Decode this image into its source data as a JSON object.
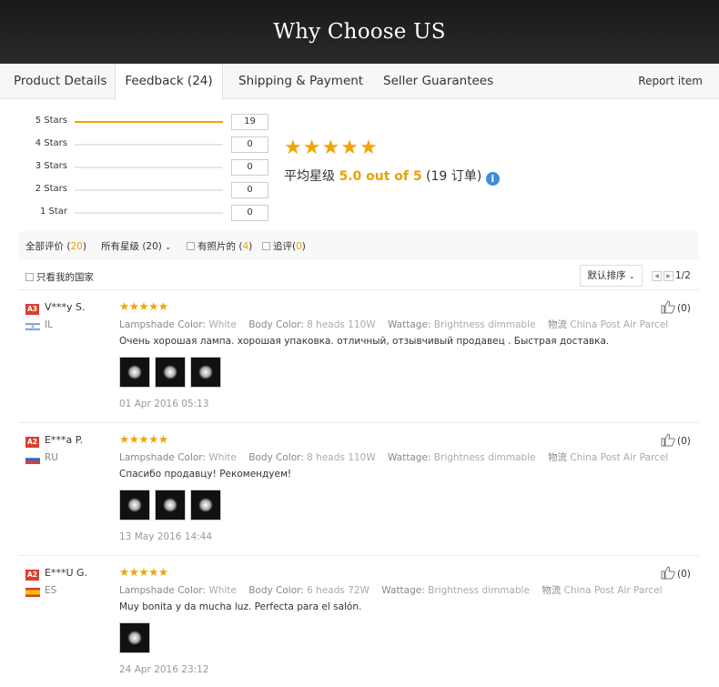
{
  "banner": {
    "title": "Why Choose US"
  },
  "tabs": [
    {
      "label": "Product Details"
    },
    {
      "label": "Feedback (24)"
    },
    {
      "label": "Shipping & Payment"
    },
    {
      "label": "Seller Guarantees"
    }
  ],
  "report_label": "Report item",
  "rating_breakdown": [
    {
      "label": "5 Stars",
      "count": "19",
      "fraction": 1.0
    },
    {
      "label": "4 Stars",
      "count": "0",
      "fraction": 0
    },
    {
      "label": "3 Stars",
      "count": "0",
      "fraction": 0
    },
    {
      "label": "2 Stars",
      "count": "0",
      "fraction": 0
    },
    {
      "label": "1 Star",
      "count": "0",
      "fraction": 0
    }
  ],
  "summary": {
    "stars": 5,
    "prefix": "平均星级 ",
    "score": "5.0 out of 5",
    "orders": " (19 订单)",
    "info_icon": "info-icon"
  },
  "filters": {
    "all_label": "全部评价 (",
    "all_count": "20",
    "all_close": ")",
    "star_filter": "所有星级 (20)",
    "photos_label": "有照片的 (",
    "photos_count": "4",
    "photos_close": ")",
    "followup_label": "追评(",
    "followup_count": "0",
    "followup_close": ")",
    "my_country": "只看我的国家",
    "sort": "默认排序",
    "page": "1/2"
  },
  "reviews": [
    {
      "badge": "A3",
      "name": "V***y S.",
      "country": "IL",
      "stars": "★★★★★",
      "attr": {
        "k1": "Lampshade Color:",
        "v1": "White",
        "k2": "Body Color:",
        "v2": "8 heads 110W",
        "k3": "Wattage:",
        "v3": "Brightness dimmable",
        "k4": "物流",
        "v4": "China Post Air Parcel"
      },
      "text": "Очень хорошая лампа. хорошая упаковка. отличный, отзывчивый продавец . Быстрая доставка.",
      "photos": 3,
      "date": "01 Apr 2016 05:13",
      "helpful": "(0)"
    },
    {
      "badge": "A2",
      "name": "E***a P.",
      "country": "RU",
      "stars": "★★★★★",
      "attr": {
        "k1": "Lampshade Color:",
        "v1": "White",
        "k2": "Body Color:",
        "v2": "8 heads 110W",
        "k3": "Wattage:",
        "v3": "Brightness dimmable",
        "k4": "物流",
        "v4": "China Post Air Parcel"
      },
      "text": "Спасибо продавцу! Рекомендуем!",
      "photos": 3,
      "date": "13 May 2016 14:44",
      "helpful": "(0)"
    },
    {
      "badge": "A2",
      "name": "E***U G.",
      "country": "ES",
      "stars": "★★★★★",
      "attr": {
        "k1": "Lampshade Color:",
        "v1": "White",
        "k2": "Body Color:",
        "v2": "6 heads 72W",
        "k3": "Wattage:",
        "v3": "Brightness dimmable",
        "k4": "物流",
        "v4": "China Post Air Parcel"
      },
      "text": "Muy bonita y da mucha luz. Perfecta para el salón.",
      "photos": 1,
      "date": "24 Apr 2016 23:12",
      "helpful": "(0)"
    }
  ],
  "colors": {
    "accent": "#f0a500",
    "badge": "#d84030",
    "info": "#3a8ed8"
  }
}
